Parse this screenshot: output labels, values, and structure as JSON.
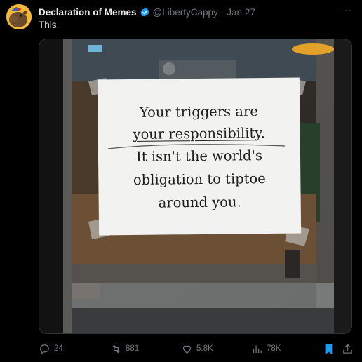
{
  "tweet": {
    "author_name": "Declaration of Memes",
    "handle": "@LibertyCappy",
    "separator": "·",
    "date": "Jan 27",
    "text": "This.",
    "more_label": "···"
  },
  "media": {
    "sign_lines": [
      "Your triggers are",
      "your responsibility.",
      "It isn't the world's",
      "obligation to tiptoe",
      "around you."
    ]
  },
  "actions": {
    "replies": "24",
    "reposts": "881",
    "likes": "5.8K",
    "views": "78K"
  },
  "colors": {
    "background": "#000000",
    "text": "#e7e9ea",
    "muted": "#71767b",
    "verified": "#1d9bf0",
    "bookmark_active": "#1d9bf0"
  },
  "icons": [
    "verified-badge-icon",
    "more-options-icon",
    "reply-icon",
    "repost-icon",
    "like-icon",
    "views-icon",
    "bookmark-icon",
    "share-icon"
  ]
}
